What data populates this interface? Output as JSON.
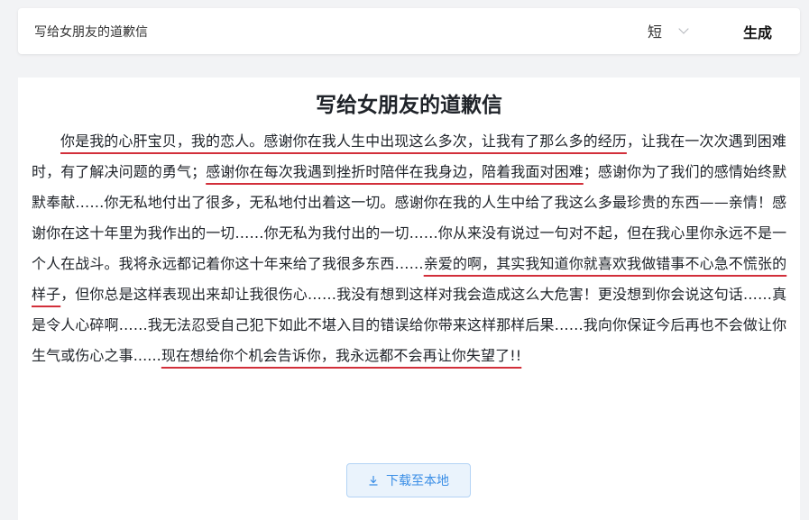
{
  "header": {
    "prompt_value": "写给女朋友的道歉信",
    "length_select_value": "短",
    "generate_label": "生成"
  },
  "letter": {
    "title": "写给女朋友的道歉信",
    "segments": [
      {
        "text": "你是我的心肝宝贝，我的恋人。感谢你在我人生中出现这么多次，让我有了那么多的经历",
        "highlight": true
      },
      {
        "text": "，让我在一次次遇到困难时，有了解决问题的勇气；",
        "highlight": false
      },
      {
        "text": "感谢你在每次我遇到挫折时陪伴在我身边，陪着我面对困难",
        "highlight": true
      },
      {
        "text": "；感谢你为了我们的感情始终默默奉献……你无私地付出了很多，无私地付出着这一切。感谢你在我的人生中给了我这么多最珍贵的东西——亲情！感谢你在这十年里为我作出的一切……你无私为我付出的一切……你从来没有说过一句对不起，但在我心里你永远不是一个人在战斗。我将永远都记着你这十年来给了我很多东西……",
        "highlight": false
      },
      {
        "text": "亲爱的啊，其实我知道你就喜欢我做错事不心急不慌张的样子",
        "highlight": true
      },
      {
        "text": "，但你总是这样表现出来却让我很伤心……我没有想到这样对我会造成这么大危害！更没想到你会说这句话……真是令人心碎啊……我无法忍受自己犯下如此不堪入目的错误给你带来这样那样后果……我向你保证今后再也不会做让你生气或伤心之事......",
        "highlight": false
      },
      {
        "text": "现在想给你个机会告诉你，我永远都不会再让你失望了!!",
        "highlight": true
      }
    ],
    "highlight_color": "#d22f3a"
  },
  "download": {
    "label": "下载至本地",
    "icon": "download-icon"
  }
}
